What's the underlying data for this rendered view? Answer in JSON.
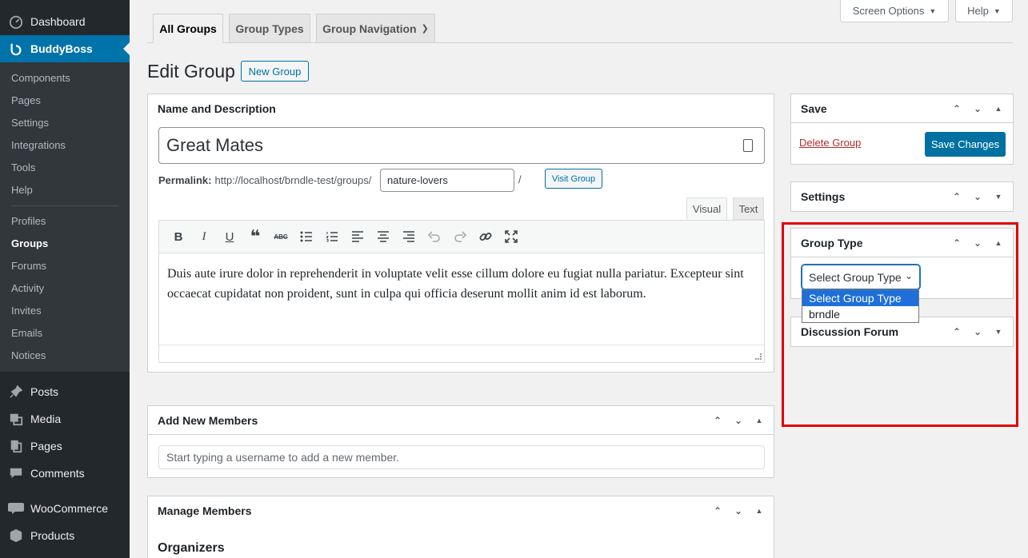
{
  "sidebar": {
    "dashboard": "Dashboard",
    "buddyboss": "BuddyBoss",
    "sub": [
      "Components",
      "Pages",
      "Settings",
      "Integrations",
      "Tools",
      "Help",
      "Profiles",
      "Groups",
      "Forums",
      "Activity",
      "Invites",
      "Emails",
      "Notices"
    ],
    "posts": "Posts",
    "media": "Media",
    "pages": "Pages",
    "comments": "Comments",
    "woocommerce": "WooCommerce",
    "products": "Products"
  },
  "top": {
    "screen_options": "Screen Options",
    "help": "Help"
  },
  "tabs": [
    "All Groups",
    "Group Types",
    "Group Navigation"
  ],
  "heading": {
    "title": "Edit Group",
    "new_group": "New Group"
  },
  "name_box": {
    "title": "Name and Description",
    "group_name": "Great Mates",
    "permalink_label": "Permalink:",
    "permalink_url": "http://localhost/brndle-test/groups/",
    "slug": "nature-lovers",
    "slash": "/",
    "visit": "Visit Group",
    "tab_visual": "Visual",
    "tab_text": "Text",
    "content": "Duis aute irure dolor in reprehenderit in voluptate velit esse cillum dolore eu fugiat nulla pariatur. Excepteur sint occaecat cupidatat non proident, sunt in culpa qui officia deserunt mollit anim id est laborum."
  },
  "add_members": {
    "title": "Add New Members",
    "placeholder": "Start typing a username to add a new member."
  },
  "manage_members": {
    "title": "Manage Members",
    "organizers": "Organizers"
  },
  "save_box": {
    "title": "Save",
    "delete": "Delete Group",
    "save": "Save Changes"
  },
  "settings_box": {
    "title": "Settings"
  },
  "group_type_box": {
    "title": "Group Type",
    "selected": "Select Group Type",
    "options": [
      "Select Group Type",
      "brndle"
    ]
  },
  "forum_box": {
    "title": "Discussion Forum"
  }
}
